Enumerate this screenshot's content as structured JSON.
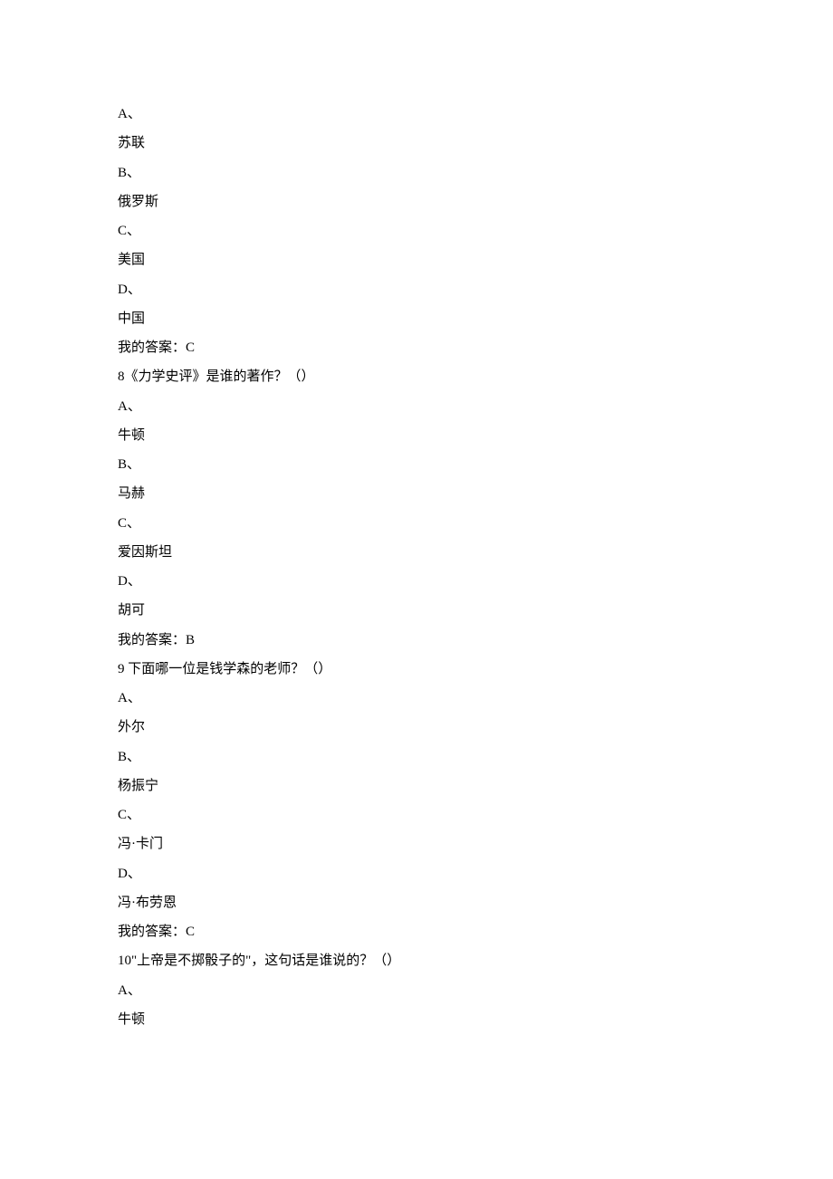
{
  "questions": [
    {
      "options": [
        {
          "label": "A、",
          "text": "苏联"
        },
        {
          "label": "B、",
          "text": "俄罗斯"
        },
        {
          "label": "C、",
          "text": "美国"
        },
        {
          "label": "D、",
          "text": "中国"
        }
      ],
      "answer": "我的答案：C"
    },
    {
      "prompt": "8《力学史评》是谁的著作？（）",
      "options": [
        {
          "label": "A、",
          "text": "牛顿"
        },
        {
          "label": "B、",
          "text": "马赫"
        },
        {
          "label": "C、",
          "text": "爱因斯坦"
        },
        {
          "label": "D、",
          "text": "胡可"
        }
      ],
      "answer": "我的答案：B"
    },
    {
      "prompt": "9 下面哪一位是钱学森的老师？（）",
      "options": [
        {
          "label": "A、",
          "text": "外尔"
        },
        {
          "label": "B、",
          "text": "杨振宁"
        },
        {
          "label": "C、",
          "text": "冯·卡门"
        },
        {
          "label": "D、",
          "text": "冯·布劳恩"
        }
      ],
      "answer": "我的答案：C"
    },
    {
      "prompt": "10\"上帝是不掷骰子的\"，这句话是谁说的？（）",
      "options": [
        {
          "label": "A、",
          "text": "牛顿"
        }
      ]
    }
  ]
}
